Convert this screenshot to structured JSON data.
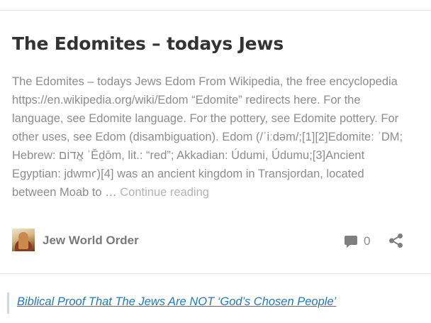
{
  "post": {
    "title": "The Edomites – todays Jews",
    "excerpt": "The Edomites – todays Jews Edom From Wikipedia, the free encyclopedia https://en.wikipedia.org/wiki/Edom “Edomite” redirects here. For the language, see Edomite language. For the pottery, see Edomite pottery. For other uses, see Edom (disambiguation). Edom (/ˈiːdəm/;[1][2]Edomite: ʾDM; Hebrew: אֱדוֹם ʾĔḏōm, lit.: “red”; Akkadian: Údumi, Údumu;[3]Ancient Egyptian: jdwmꜥ)[4] was an ancient kingdom in Transjordan, located between Moab to … ",
    "continue_label": "Continue reading"
  },
  "meta": {
    "author": "Jew World Order",
    "comment_count": "0",
    "comment_icon": "comment-bubble-icon",
    "share_icon": "share-icon"
  },
  "related": {
    "link_text": "Biblical Proof That The Jews Are NOT ‘God’s Chosen People’"
  },
  "colors": {
    "title": "#333333",
    "body_text": "#8c8c8c",
    "link": "#1a7bb9"
  }
}
